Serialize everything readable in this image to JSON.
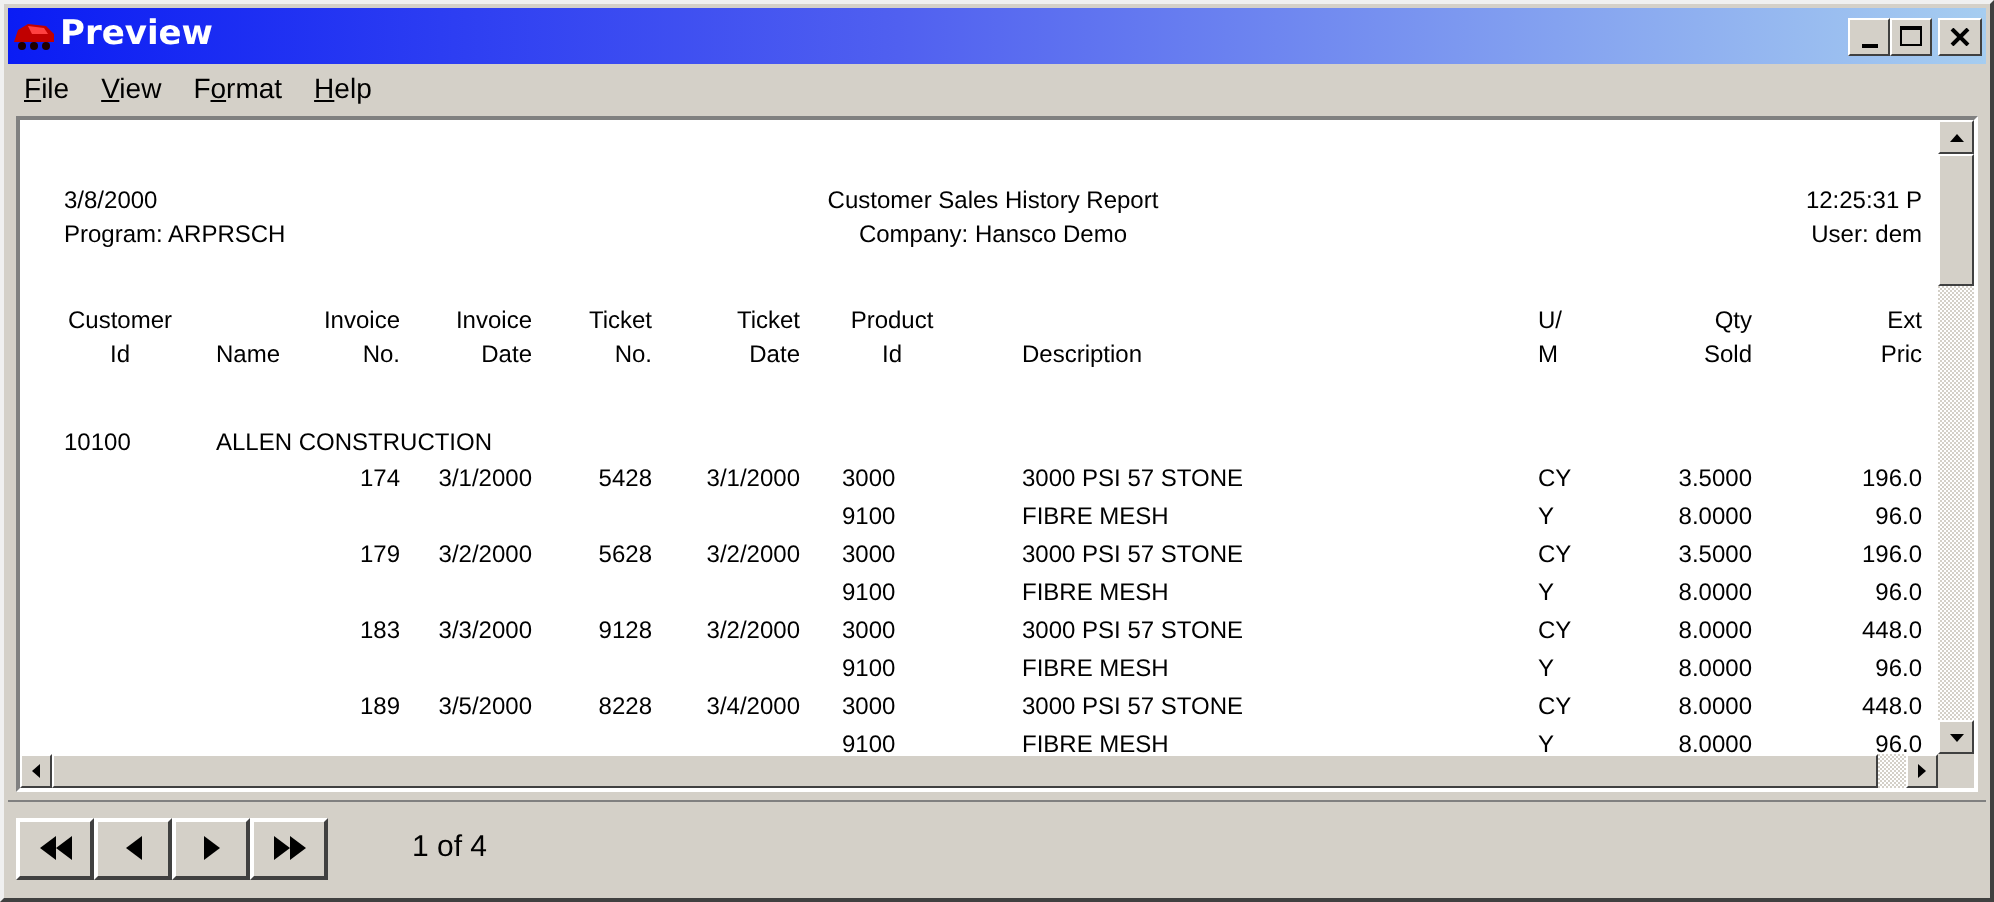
{
  "window": {
    "title": "Preview"
  },
  "menu": [
    {
      "parts": [
        {
          "text": "F",
          "underline": true
        },
        {
          "text": "ile",
          "underline": false
        }
      ]
    },
    {
      "parts": [
        {
          "text": "V",
          "underline": true
        },
        {
          "text": "iew",
          "underline": false
        }
      ]
    },
    {
      "parts": [
        {
          "text": "F",
          "underline": false
        },
        {
          "text": "o",
          "underline": true
        },
        {
          "text": "rmat",
          "underline": false
        }
      ]
    },
    {
      "parts": [
        {
          "text": "H",
          "underline": true
        },
        {
          "text": "elp",
          "underline": false
        }
      ]
    }
  ],
  "report": {
    "header": {
      "left": [
        "3/8/2000",
        "Program: ARPRSCH"
      ],
      "center": [
        "Customer Sales History Report",
        "Company: Hansco Demo"
      ],
      "right": [
        "12:25:31 P",
        "User: dem"
      ]
    },
    "columns": [
      "Customer\nId",
      "Name",
      "Invoice\nNo.",
      "Invoice\nDate",
      "Ticket\nNo.",
      "Ticket\nDate",
      "Product\nId",
      "Description",
      "U/\nM",
      "Qty\nSold",
      "Ext\nPric"
    ],
    "customers": [
      {
        "id": "10100",
        "name": "ALLEN CONSTRUCTION",
        "lines": [
          {
            "invoice_no": "174",
            "invoice_date": "3/1/2000",
            "ticket_no": "5428",
            "ticket_date": "3/1/2000",
            "product_id": "3000",
            "description": "3000 PSI 57 STONE",
            "um": "CY",
            "qty_sold": "3.5000",
            "ext_price": "196.0"
          },
          {
            "product_id": "9100",
            "description": "FIBRE MESH",
            "um": "Y",
            "qty_sold": "8.0000",
            "ext_price": "96.0"
          },
          {
            "invoice_no": "179",
            "invoice_date": "3/2/2000",
            "ticket_no": "5628",
            "ticket_date": "3/2/2000",
            "product_id": "3000",
            "description": "3000 PSI 57 STONE",
            "um": "CY",
            "qty_sold": "3.5000",
            "ext_price": "196.0"
          },
          {
            "product_id": "9100",
            "description": "FIBRE MESH",
            "um": "Y",
            "qty_sold": "8.0000",
            "ext_price": "96.0"
          },
          {
            "invoice_no": "183",
            "invoice_date": "3/3/2000",
            "ticket_no": "9128",
            "ticket_date": "3/2/2000",
            "product_id": "3000",
            "description": "3000 PSI 57 STONE",
            "um": "CY",
            "qty_sold": "8.0000",
            "ext_price": "448.0"
          },
          {
            "product_id": "9100",
            "description": "FIBRE MESH",
            "um": "Y",
            "qty_sold": "8.0000",
            "ext_price": "96.0"
          },
          {
            "invoice_no": "189",
            "invoice_date": "3/5/2000",
            "ticket_no": "8228",
            "ticket_date": "3/4/2000",
            "product_id": "3000",
            "description": "3000 PSI 57 STONE",
            "um": "CY",
            "qty_sold": "8.0000",
            "ext_price": "448.0"
          },
          {
            "product_id": "9100",
            "description": "FIBRE MESH",
            "um": "Y",
            "qty_sold": "8.0000",
            "ext_price": "96.0"
          }
        ]
      }
    ]
  },
  "pager": {
    "label": "1 of 4"
  }
}
